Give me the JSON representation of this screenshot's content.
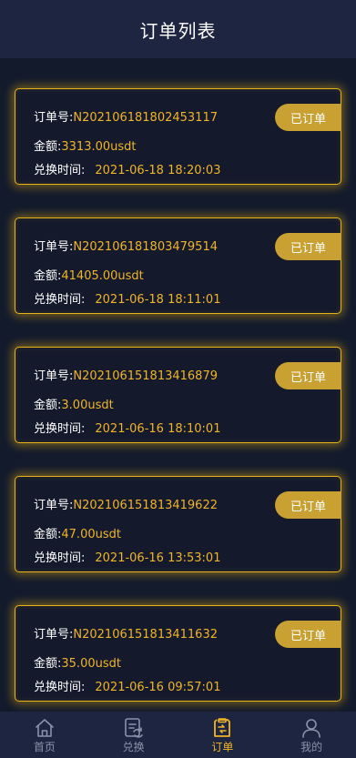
{
  "header": {
    "title": "订单列表"
  },
  "orders": [
    {
      "order_no_label": "订单号:",
      "order_no": "N202106181802453117",
      "amount_label": "金额:",
      "amount": "3313.00usdt",
      "time_label": "兑换时间:",
      "time": "2021-06-18 18:20:03",
      "status": "已订单"
    },
    {
      "order_no_label": "订单号:",
      "order_no": "N202106181803479514",
      "amount_label": "金额:",
      "amount": "41405.00usdt",
      "time_label": "兑换时间:",
      "time": "2021-06-18 18:11:01",
      "status": "已订单"
    },
    {
      "order_no_label": "订单号:",
      "order_no": "N202106151813416879",
      "amount_label": "金额:",
      "amount": "3.00usdt",
      "time_label": "兑换时间:",
      "time": "2021-06-16 18:10:01",
      "status": "已订单"
    },
    {
      "order_no_label": "订单号:",
      "order_no": "N202106151813419622",
      "amount_label": "金额:",
      "amount": "47.00usdt",
      "time_label": "兑换时间:",
      "time": "2021-06-16 13:53:01",
      "status": "已订单"
    },
    {
      "order_no_label": "订单号:",
      "order_no": "N202106151813411632",
      "amount_label": "金额:",
      "amount": "35.00usdt",
      "time_label": "兑换时间:",
      "time": "2021-06-16 09:57:01",
      "status": "已订单"
    }
  ],
  "tabbar": {
    "items": [
      {
        "label": "首页",
        "icon": "home-icon",
        "active": false
      },
      {
        "label": "兑换",
        "icon": "exchange-icon",
        "active": false
      },
      {
        "label": "订单",
        "icon": "order-icon",
        "active": true
      },
      {
        "label": "我的",
        "icon": "user-icon",
        "active": false
      }
    ]
  },
  "colors": {
    "background": "#121a2c",
    "bar": "#1d2540",
    "accent": "#f0b428",
    "badge": "#c9a032",
    "inactive": "#8b93aa"
  }
}
